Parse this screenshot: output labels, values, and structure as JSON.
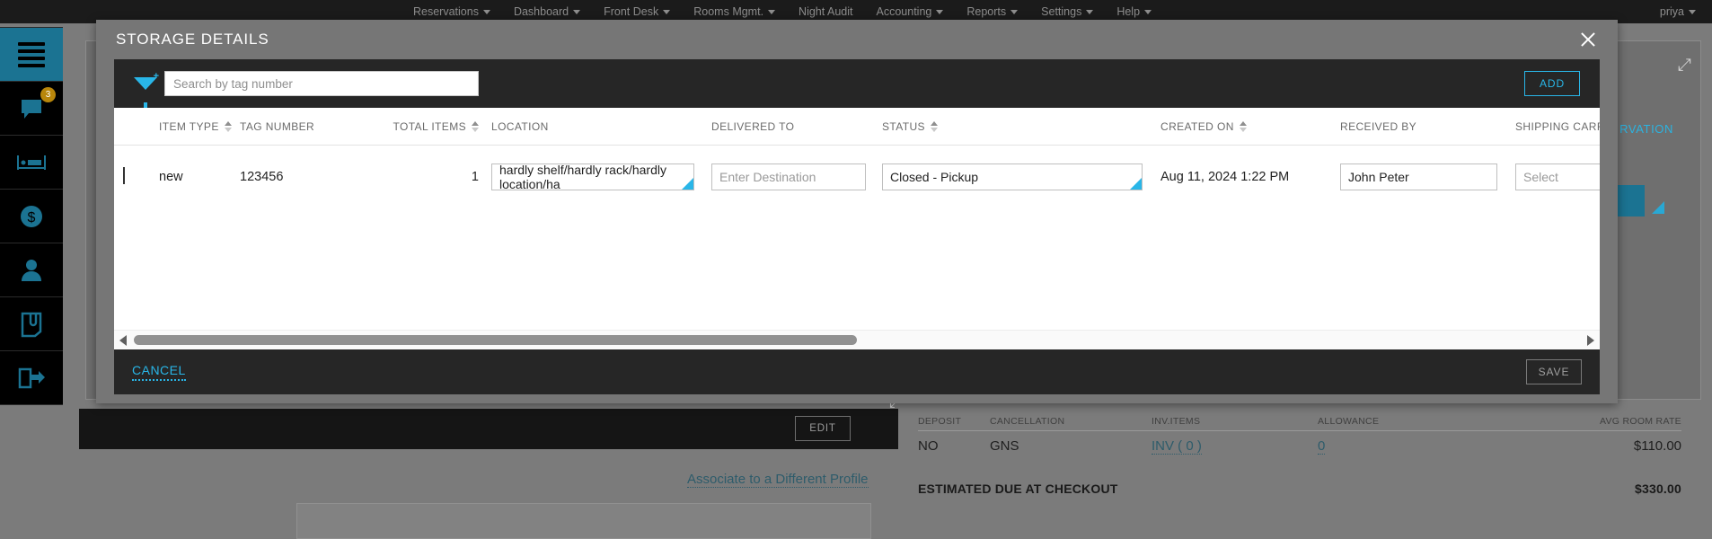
{
  "topnav": {
    "items": [
      {
        "label": "Reservations",
        "has_caret": true
      },
      {
        "label": "Dashboard",
        "has_caret": true
      },
      {
        "label": "Front Desk",
        "has_caret": true
      },
      {
        "label": "Rooms Mgmt.",
        "has_caret": true
      },
      {
        "label": "Night Audit",
        "has_caret": false
      },
      {
        "label": "Accounting",
        "has_caret": true
      },
      {
        "label": "Reports",
        "has_caret": true
      },
      {
        "label": "Settings",
        "has_caret": true
      },
      {
        "label": "Help",
        "has_caret": true
      }
    ],
    "user": "priya"
  },
  "rail": {
    "items": [
      {
        "icon": "hamburger-menu-icon",
        "badge": ""
      },
      {
        "icon": "chat-bubble-icon",
        "badge": "3"
      },
      {
        "icon": "bed-icon",
        "badge": ""
      },
      {
        "icon": "dollar-circle-icon",
        "badge": ""
      },
      {
        "icon": "person-icon",
        "badge": ""
      },
      {
        "icon": "document-clip-icon",
        "badge": ""
      },
      {
        "icon": "checkout-arrow-icon",
        "badge": ""
      }
    ]
  },
  "background": {
    "reservation_label": "RVATION",
    "edit_label": "EDIT",
    "associate_link": "Associate to a Different Profile",
    "summary": {
      "headers": [
        "DEPOSIT",
        "CANCELLATION",
        "INV.ITEMS",
        "ALLOWANCE",
        "AVG ROOM RATE"
      ],
      "values": [
        "NO",
        "GNS",
        "INV ( 0 )",
        "0",
        "$110.00"
      ],
      "total_label": "ESTIMATED DUE AT CHECKOUT",
      "total_value": "$330.00"
    }
  },
  "modal": {
    "title": "STORAGE DETAILS",
    "close_icon": "close-icon",
    "toolbar": {
      "filter_icon": "filter-funnel-add-icon",
      "search_placeholder": "Search by tag number",
      "search_value": "",
      "add_label": "ADD"
    },
    "grid": {
      "columns": [
        {
          "key": "expand",
          "label": "",
          "sortable": false
        },
        {
          "key": "type",
          "label": "ITEM TYPE",
          "sortable": true
        },
        {
          "key": "tag",
          "label": "TAG NUMBER",
          "sortable": false
        },
        {
          "key": "total",
          "label": "TOTAL ITEMS",
          "sortable": true
        },
        {
          "key": "loc",
          "label": "LOCATION",
          "sortable": false
        },
        {
          "key": "dest",
          "label": "DELIVERED TO",
          "sortable": false
        },
        {
          "key": "status",
          "label": "STATUS",
          "sortable": true
        },
        {
          "key": "created",
          "label": "CREATED ON",
          "sortable": true
        },
        {
          "key": "recv",
          "label": "RECEIVED BY",
          "sortable": false
        },
        {
          "key": "ship",
          "label": "SHIPPING CARRIER",
          "sortable": false
        }
      ],
      "rows": [
        {
          "item_type": "new",
          "tag_number": "123456",
          "total_items": "1",
          "location_value": "hardly shelf/hardly rack/hardly location/ha",
          "delivered_to_value": "",
          "delivered_to_placeholder": "Enter Destination",
          "status_value": "Closed - Pickup",
          "created_on": "Aug 11, 2024 1:22 PM",
          "received_by_value": "John Peter",
          "shipping_carrier_value": "",
          "shipping_carrier_placeholder": "Select"
        }
      ]
    },
    "footer": {
      "cancel_label": "CANCEL",
      "save_label": "SAVE"
    }
  },
  "colors": {
    "accent_cyan": "#29b6e8",
    "teal": "#1b7392",
    "modal_chrome": "#767676",
    "dark_bar": "#262626"
  }
}
